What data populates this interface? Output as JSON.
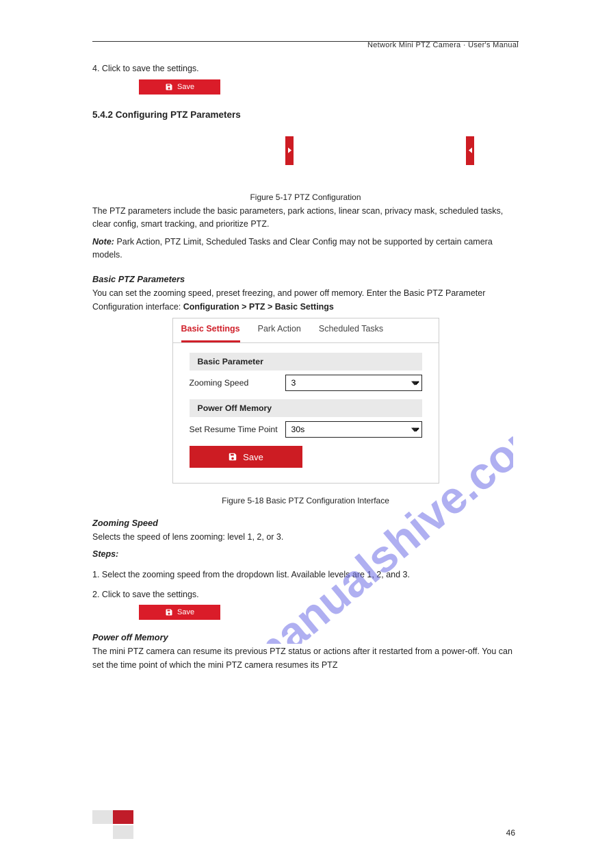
{
  "header": {
    "text": "Network Mini PTZ Camera · User's Manual"
  },
  "step4a": {
    "num": "4.",
    "pre": "Click ",
    "post": " to save the settings."
  },
  "save_label": "Save",
  "sec_title": "5.4.2 Configuring PTZ Parameters",
  "expand": {
    "btn_left_label": "Expand",
    "btn_right_label": "Collapse"
  },
  "fig_caption_expand": "Figure 5-17 PTZ Configuration",
  "sec_text": "The PTZ parameters include the basic parameters, park actions, linear scan, privacy mask, scheduled tasks, clear config, smart tracking, and prioritize PTZ.",
  "note_label": "Note:",
  "note_text": "Park Action, PTZ Limit, Scheduled Tasks and Clear Config may not be supported by certain camera models.",
  "basic_head": "Basic PTZ Parameters",
  "basic_text_pre": "You can set the zooming speed, preset freezing, and power off memory. Enter the Basic PTZ Parameter Configuration interface: ",
  "basic_text_path": "Configuration > PTZ > Basic Settings",
  "fig_caption_basic": "Figure 5-18 Basic PTZ Configuration Interface",
  "figbox": {
    "tab1": "Basic Settings",
    "tab2": "Park Action",
    "tab3": "Scheduled Tasks",
    "g1": "Basic Parameter",
    "zoom_lbl": "Zooming Speed",
    "zoom_val": "3",
    "g2": "Power Off Memory",
    "resume_lbl": "Set Resume Time Point",
    "resume_val": "30s",
    "save": "Save"
  },
  "zoom_sec_title": "Zooming Speed",
  "zoom_sec_text": "Selects the speed of lens zooming: level 1, 2, or 3.",
  "steps_title": "Steps:",
  "z_step1": {
    "num": "1.",
    "text": "Select the zooming speed from the dropdown list. Available levels are 1, 2, and 3."
  },
  "z_step2": {
    "num": "2.",
    "pre": "Click ",
    "post": " to save the settings."
  },
  "pom_title": "Power off Memory",
  "pom_text": "The mini PTZ camera can resume its previous PTZ status or actions after it restarted from a power-off. You can set the time point of which the mini PTZ camera resumes its PTZ",
  "footer": {
    "pageno": "46"
  }
}
